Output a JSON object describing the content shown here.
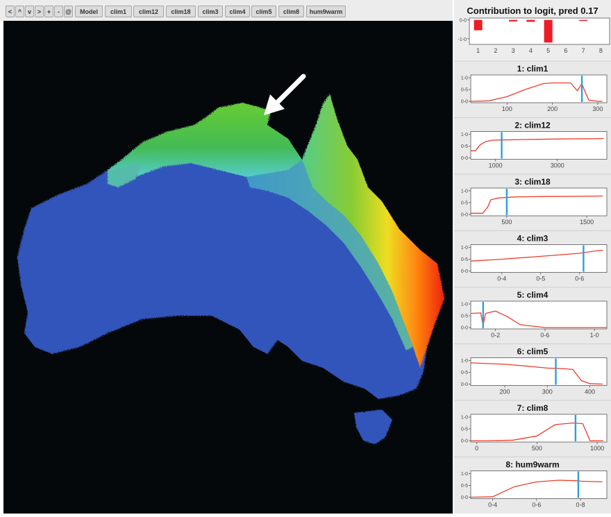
{
  "toolbar": {
    "buttons": [
      {
        "label": "<"
      },
      {
        "label": "^"
      },
      {
        "label": "v"
      },
      {
        "label": ">"
      },
      {
        "label": "+"
      },
      {
        "label": "-"
      },
      {
        "label": "@"
      },
      {
        "label": "Model"
      },
      {
        "label": "clim1"
      },
      {
        "label": "clim12"
      },
      {
        "label": "clim18"
      },
      {
        "label": "clim3"
      },
      {
        "label": "clim4"
      },
      {
        "label": "clim5"
      },
      {
        "label": "clim8"
      },
      {
        "label": "hum9warm"
      }
    ]
  },
  "map": {
    "arrow_color": "#ffffff",
    "colors": {
      "low": "#3355bb",
      "mid": "#44bb44",
      "high": "#ee3311"
    }
  },
  "side": {
    "contribution": {
      "title": "Contribution to logit, pred 0.17",
      "y_ticks": [
        "0-0",
        "-1-0"
      ],
      "x_ticks": [
        "1",
        "2",
        "3",
        "4",
        "5",
        "6",
        "7",
        "8"
      ],
      "bar_color": "#ee1c24"
    },
    "line_color": "#ee3b2a",
    "marker_color": "#2e9fd8"
  },
  "chart_data": [
    {
      "type": "bar",
      "title": "Contribution to logit, pred 0.17",
      "categories": [
        "1",
        "2",
        "3",
        "4",
        "5",
        "6",
        "7",
        "8"
      ],
      "values": [
        -0.55,
        0.0,
        -0.08,
        -0.1,
        -1.2,
        0.0,
        -0.05,
        0.0
      ],
      "ylim": [
        -1.3,
        0.1
      ]
    },
    {
      "type": "line",
      "title": "1: clim1",
      "x": [
        20,
        60,
        100,
        140,
        180,
        200,
        240,
        255,
        265,
        270,
        280,
        300,
        310
      ],
      "y": [
        0.0,
        0.02,
        0.2,
        0.5,
        0.75,
        0.78,
        0.78,
        0.45,
        0.75,
        0.5,
        0.05,
        0.0,
        0.0
      ],
      "marker": 265,
      "xlim": [
        20,
        320
      ],
      "ylim": [
        0,
        1
      ],
      "y_ticks": [
        "1-0",
        "0-5",
        "0-0"
      ],
      "x_ticks": [
        100,
        200,
        300
      ]
    },
    {
      "type": "line",
      "title": "2: clim12",
      "x": [
        200,
        350,
        500,
        700,
        900,
        1200,
        2000,
        3000,
        4500
      ],
      "y": [
        0.3,
        0.3,
        0.55,
        0.7,
        0.75,
        0.76,
        0.78,
        0.8,
        0.82
      ],
      "marker": 1200,
      "xlim": [
        200,
        4600
      ],
      "ylim": [
        0,
        1
      ],
      "y_ticks": [
        "1-0",
        "0-5",
        "0-0"
      ],
      "x_ticks": [
        1000,
        3000
      ]
    },
    {
      "type": "line",
      "title": "3: clim18",
      "x": [
        50,
        200,
        260,
        300,
        400,
        600,
        1000,
        1700
      ],
      "y": [
        0.05,
        0.05,
        0.3,
        0.62,
        0.7,
        0.74,
        0.76,
        0.78
      ],
      "marker": 500,
      "xlim": [
        50,
        1750
      ],
      "ylim": [
        0,
        1
      ],
      "y_ticks": [
        "1-0",
        "0-5",
        "0-0"
      ],
      "x_ticks": [
        500,
        1500
      ]
    },
    {
      "type": "line",
      "title": "4: clim3",
      "x": [
        0.32,
        0.4,
        0.5,
        0.6,
        0.64,
        0.66
      ],
      "y": [
        0.42,
        0.5,
        0.62,
        0.75,
        0.85,
        0.88
      ],
      "marker": 0.61,
      "xlim": [
        0.32,
        0.67
      ],
      "ylim": [
        0,
        1
      ],
      "y_ticks": [
        "1-0",
        "0-5",
        "0-0"
      ],
      "x_ticks": [
        "0-4",
        "0-5",
        "0-6"
      ]
    },
    {
      "type": "line",
      "title": "5: clim4",
      "x": [
        0.0,
        0.08,
        0.1,
        0.12,
        0.2,
        0.3,
        0.4,
        0.6,
        1.1
      ],
      "y": [
        0.6,
        0.62,
        0.1,
        0.6,
        0.7,
        0.45,
        0.12,
        0.0,
        0.0
      ],
      "marker": 0.1,
      "xlim": [
        0.0,
        1.1
      ],
      "ylim": [
        0,
        1
      ],
      "y_ticks": [
        "1-0",
        "0-5",
        "0-0"
      ],
      "x_ticks": [
        "0-2",
        "0-6",
        "1-0"
      ]
    },
    {
      "type": "line",
      "title": "6: clim5",
      "x": [
        120,
        200,
        260,
        300,
        340,
        360,
        380,
        400,
        430
      ],
      "y": [
        0.9,
        0.84,
        0.75,
        0.68,
        0.65,
        0.62,
        0.15,
        0.02,
        0.0
      ],
      "marker": 320,
      "xlim": [
        120,
        440
      ],
      "ylim": [
        0,
        1
      ],
      "y_ticks": [
        "1-0",
        "0-5",
        "0-0"
      ],
      "x_ticks": [
        200,
        300,
        400
      ]
    },
    {
      "type": "line",
      "title": "7: clim8",
      "x": [
        -50,
        100,
        300,
        500,
        650,
        800,
        880,
        940,
        1050
      ],
      "y": [
        0.0,
        0.0,
        0.02,
        0.2,
        0.68,
        0.75,
        0.72,
        0.0,
        0.0
      ],
      "marker": 820,
      "xlim": [
        -50,
        1080
      ],
      "ylim": [
        0,
        1
      ],
      "y_ticks": [
        "1-0",
        "0-5",
        "0-0"
      ],
      "x_ticks": [
        0,
        500,
        1000
      ]
    },
    {
      "type": "line",
      "title": "8: hum9warm",
      "x": [
        0.3,
        0.4,
        0.5,
        0.6,
        0.7,
        0.78,
        0.8,
        0.9
      ],
      "y": [
        0.0,
        0.02,
        0.45,
        0.65,
        0.72,
        0.7,
        0.68,
        0.65
      ],
      "marker": 0.79,
      "xlim": [
        0.3,
        0.92
      ],
      "ylim": [
        0,
        1
      ],
      "y_ticks": [
        "1-0",
        "0-5",
        "0-0"
      ],
      "x_ticks": [
        "0-4",
        "0-6",
        "0-8"
      ]
    }
  ]
}
